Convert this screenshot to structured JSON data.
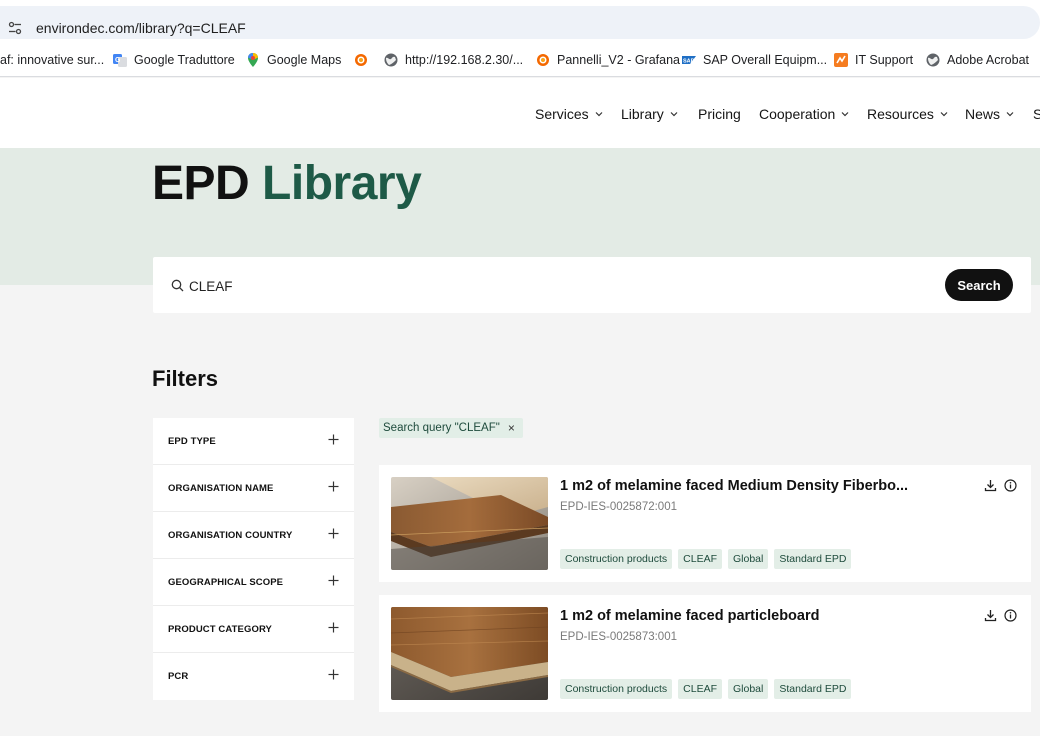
{
  "browser": {
    "url": "environdec.com/library?q=CLEAF",
    "bookmarks": [
      {
        "label": "af: innovative sur...",
        "icon": "none"
      },
      {
        "label": "Google Traduttore",
        "icon": "translate-icon"
      },
      {
        "label": "Google Maps",
        "icon": "maps-pin-icon"
      },
      {
        "label": "",
        "icon": "grafana-icon"
      },
      {
        "label": "http://192.168.2.30/...",
        "icon": "globe-icon"
      },
      {
        "label": "Pannelli_V2 - Grafana",
        "icon": "grafana-icon"
      },
      {
        "label": "SAP Overall Equipm...",
        "icon": "sap-icon"
      },
      {
        "label": "IT Support",
        "icon": "support-icon"
      },
      {
        "label": "Adobe Acrobat",
        "icon": "globe-icon"
      }
    ]
  },
  "nav": {
    "items": [
      {
        "label": "Services",
        "dropdown": true
      },
      {
        "label": "Library",
        "dropdown": true
      },
      {
        "label": "Pricing",
        "dropdown": false
      },
      {
        "label": "Cooperation",
        "dropdown": true
      },
      {
        "label": "Resources",
        "dropdown": true
      },
      {
        "label": "News",
        "dropdown": true
      },
      {
        "label": "S",
        "dropdown": false
      }
    ]
  },
  "hero": {
    "title_main": "EPD",
    "title_accent": "Library"
  },
  "search": {
    "value": "CLEAF",
    "button_label": "Search"
  },
  "filters": {
    "title": "Filters",
    "items": [
      "EPD TYPE",
      "ORGANISATION NAME",
      "ORGANISATION COUNTRY",
      "GEOGRAPHICAL SCOPE",
      "PRODUCT CATEGORY",
      "PCR"
    ]
  },
  "active_filter": {
    "label": "Search query \"CLEAF\"",
    "remove": "×"
  },
  "results": [
    {
      "title": "1 m2 of melamine faced Medium Density Fiberbo...",
      "code": "EPD-IES-0025872:001",
      "tags": [
        "Construction products",
        "CLEAF",
        "Global",
        "Standard EPD"
      ]
    },
    {
      "title": "1 m2 of melamine faced particleboard",
      "code": "EPD-IES-0025873:001",
      "tags": [
        "Construction products",
        "CLEAF",
        "Global",
        "Standard EPD"
      ]
    }
  ],
  "colors": {
    "accent": "#1e5a47",
    "hero_bg": "#e3ebe5",
    "tag_bg": "#e3eee7"
  }
}
